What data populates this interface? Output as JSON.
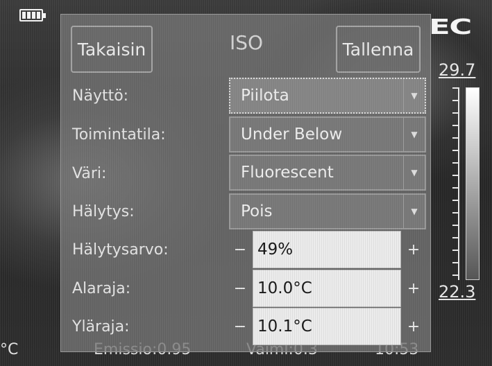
{
  "brand": "EC",
  "scale": {
    "max": "29.7",
    "min": "22.3"
  },
  "status": {
    "unit": "°C",
    "emissivity": "Emissio:0.95",
    "middle": "Vaiml:0.3",
    "right": "10:53"
  },
  "dialog": {
    "title": "ISO",
    "back_label": "Takaisin",
    "save_label": "Tallenna",
    "rows": [
      {
        "label": "Näyttö:",
        "value": "Piilota"
      },
      {
        "label": "Toimintatila:",
        "value": "Under Below"
      },
      {
        "label": "Väri:",
        "value": "Fluorescent"
      },
      {
        "label": "Hälytys:",
        "value": "Pois"
      }
    ],
    "steppers": [
      {
        "label": "Hälytysarvo:",
        "value": "49%",
        "minus": "−",
        "plus": "+"
      },
      {
        "label": "Alaraja:",
        "value": "10.0°C",
        "minus": "−",
        "plus": "+"
      },
      {
        "label": "Yläraja:",
        "value": "10.1°C",
        "minus": "−",
        "plus": "+"
      }
    ]
  },
  "icons": {
    "battery": "battery-icon",
    "dropdown": "chevron-down-icon"
  }
}
